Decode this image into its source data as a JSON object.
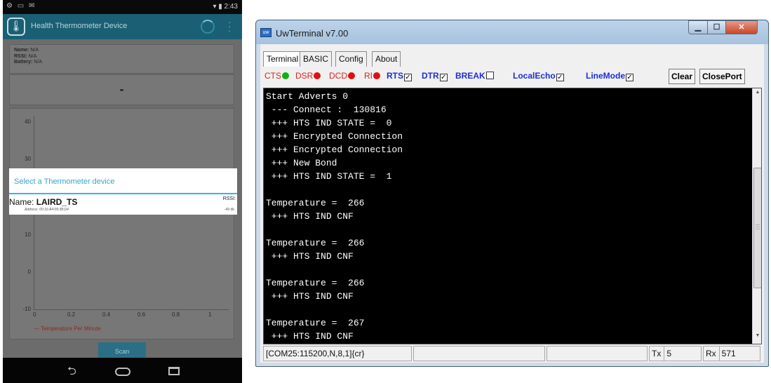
{
  "phone": {
    "status_bar": {
      "left_icons": "⚙ ▭ ✉",
      "time": "2:43",
      "signal_icons": "▾ ▮"
    },
    "app_bar": {
      "title": "Health Thermometer Device",
      "icon": "thermometer-icon"
    },
    "info": {
      "name_label": "Name:",
      "name_value": "N/A",
      "rssi_label": "RSSI:",
      "rssi_value": "N/A",
      "battery_label": "Battery:",
      "battery_value": "N/A"
    },
    "temperature_value": "-",
    "chart": {
      "y_ticks": [
        "40",
        "30",
        "10",
        "0",
        "-10"
      ],
      "x_ticks": [
        "0",
        "0.2",
        "0.4",
        "0.6",
        "0.8",
        "1"
      ],
      "legend": "Temperature Per Minute"
    },
    "scan_button": "Scan",
    "dialog": {
      "title": "Select a Thermometer device",
      "device_name_label": "Name:",
      "device_name": "LAIRD_TS",
      "device_address": "Address: 00:16:A4:09:38:D4",
      "rssi_label": "RSSI:",
      "rssi_value": "-49 db"
    }
  },
  "terminal_window": {
    "title": "UwTerminal v7.00",
    "tabs": [
      "Terminal",
      "BASIC",
      "Config",
      "About"
    ],
    "controls": {
      "cts": "CTS",
      "dsr": "DSR",
      "dcd": "DCD",
      "ri": "RI",
      "rts": "RTS",
      "dtr": "DTR",
      "break": "BREAK",
      "local_echo": "LocalEcho",
      "line_mode": "LineMode",
      "clear": "Clear",
      "close_port": "ClosePort"
    },
    "led_colors": {
      "cts": "#10b010",
      "dsr": "#e01010",
      "dcd": "#e01010",
      "ri": "#e01010"
    },
    "terminal_output": "Start Adverts 0\n --- Connect :  130816\n +++ HTS IND STATE =  0\n +++ Encrypted Connection\n +++ Encrypted Connection\n +++ New Bond\n +++ HTS IND STATE =  1\n\nTemperature =  266\n +++ HTS IND CNF\n\nTemperature =  266\n +++ HTS IND CNF\n\nTemperature =  266\n +++ HTS IND CNF\n\nTemperature =  267\n +++ HTS IND CNF",
    "status": {
      "port": "[COM25:115200,N,8,1]{cr}",
      "tx_label": "Tx",
      "tx_value": "5",
      "rx_label": "Rx",
      "rx_value": "571"
    }
  }
}
